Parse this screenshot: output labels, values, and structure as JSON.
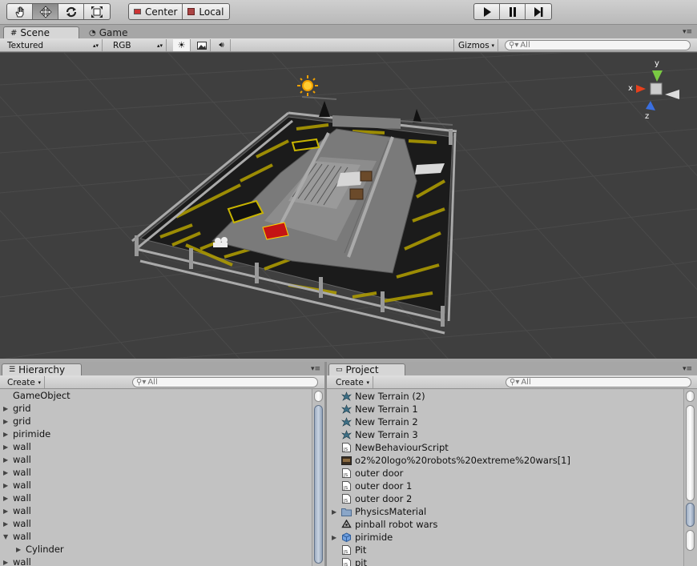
{
  "toolbar": {
    "tools": [
      {
        "name": "hand-tool-button",
        "icon": "hand-icon"
      },
      {
        "name": "move-tool-button",
        "icon": "move-arrows-icon"
      },
      {
        "name": "rotate-tool-button",
        "icon": "rotate-icon"
      },
      {
        "name": "scale-tool-button",
        "icon": "scale-icon"
      }
    ],
    "pivot_label": "Center",
    "space_label": "Local",
    "play_controls": [
      "play-icon",
      "pause-icon",
      "step-icon"
    ]
  },
  "scene_panel": {
    "tabs": [
      {
        "label": "Scene",
        "active": true
      },
      {
        "label": "Game",
        "active": false
      }
    ],
    "render_mode": "Textured",
    "color_mode": "RGB",
    "gizmos_label": "Gizmos",
    "search_placeholder": "All",
    "axis_labels": {
      "y": "y",
      "x": "x",
      "z": "z"
    }
  },
  "hierarchy": {
    "tab_label": "Hierarchy",
    "create_label": "Create",
    "search_placeholder": "All",
    "items": [
      {
        "label": "GameObject",
        "indent": 0,
        "fold": "none"
      },
      {
        "label": "grid",
        "indent": 0,
        "fold": "collapsed"
      },
      {
        "label": "grid",
        "indent": 0,
        "fold": "collapsed"
      },
      {
        "label": "pirimide",
        "indent": 0,
        "fold": "collapsed"
      },
      {
        "label": "wall",
        "indent": 0,
        "fold": "collapsed"
      },
      {
        "label": "wall",
        "indent": 0,
        "fold": "collapsed"
      },
      {
        "label": "wall",
        "indent": 0,
        "fold": "collapsed"
      },
      {
        "label": "wall",
        "indent": 0,
        "fold": "collapsed"
      },
      {
        "label": "wall",
        "indent": 0,
        "fold": "collapsed"
      },
      {
        "label": "wall",
        "indent": 0,
        "fold": "collapsed"
      },
      {
        "label": "wall",
        "indent": 0,
        "fold": "collapsed"
      },
      {
        "label": "wall",
        "indent": 0,
        "fold": "expanded"
      },
      {
        "label": "Cylinder",
        "indent": 1,
        "fold": "collapsed"
      },
      {
        "label": "wall",
        "indent": 0,
        "fold": "collapsed"
      }
    ]
  },
  "project": {
    "tab_label": "Project",
    "create_label": "Create",
    "search_placeholder": "All",
    "items": [
      {
        "label": "New Terrain (2)",
        "icon": "terrain-icon",
        "fold": "none"
      },
      {
        "label": "New Terrain 1",
        "icon": "terrain-icon",
        "fold": "none"
      },
      {
        "label": "New Terrain 2",
        "icon": "terrain-icon",
        "fold": "none"
      },
      {
        "label": "New Terrain 3",
        "icon": "terrain-icon",
        "fold": "none"
      },
      {
        "label": "NewBehaviourScript",
        "icon": "script-icon",
        "fold": "none"
      },
      {
        "label": "o2%20logo%20robots%20extreme%20wars[1]",
        "icon": "texture-icon",
        "fold": "none"
      },
      {
        "label": "outer door",
        "icon": "script-icon",
        "fold": "none"
      },
      {
        "label": "outer door 1",
        "icon": "script-icon",
        "fold": "none"
      },
      {
        "label": "outer door 2",
        "icon": "script-icon",
        "fold": "none"
      },
      {
        "label": "PhysicsMaterial",
        "icon": "folder-icon",
        "fold": "collapsed"
      },
      {
        "label": "pinball robot wars",
        "icon": "unity-scene-icon",
        "fold": "none"
      },
      {
        "label": "pirimide",
        "icon": "prefab-icon",
        "fold": "collapsed"
      },
      {
        "label": "Pit",
        "icon": "script-icon",
        "fold": "none"
      },
      {
        "label": "pit",
        "icon": "script-icon",
        "fold": "none"
      }
    ]
  },
  "colors": {
    "scene_bg": "#3f3f3f",
    "panel_bg": "#c2c2c2",
    "hazard_yellow": "#c8b400",
    "scrollbar_thumb": "#9dadc2"
  }
}
